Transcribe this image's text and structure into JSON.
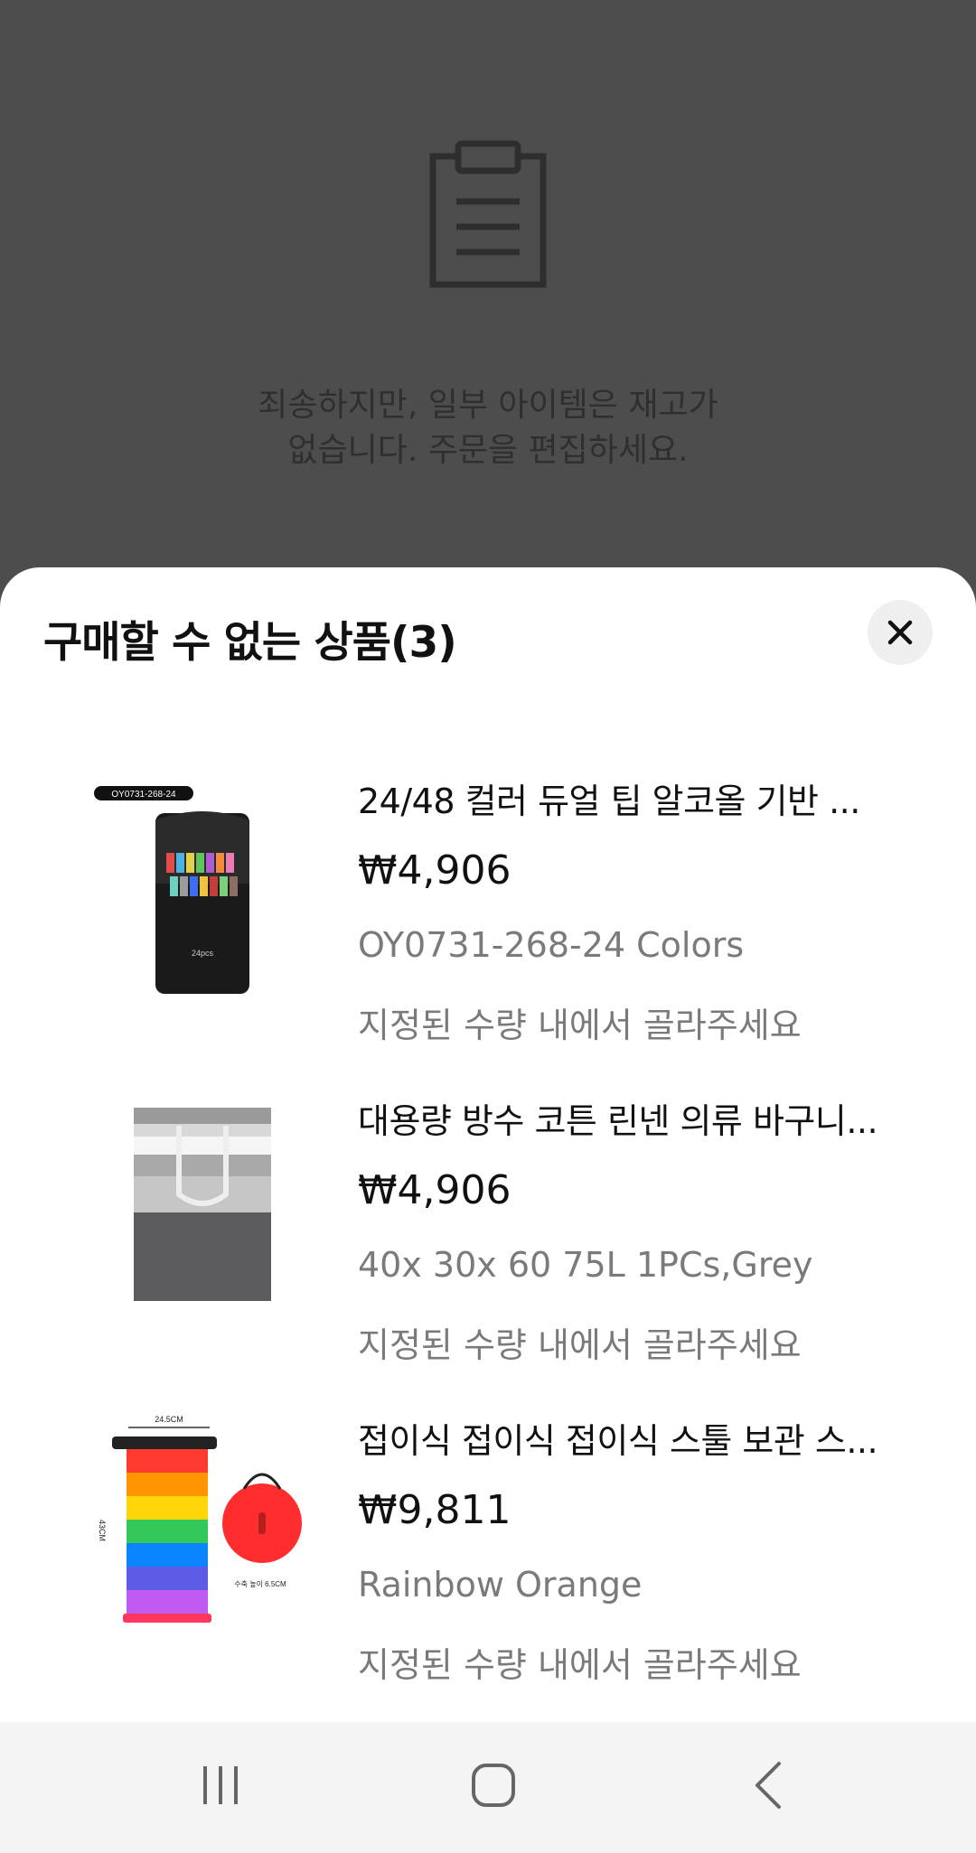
{
  "background": {
    "message": "죄송하지만, 일부 아이템은 재고가\n없습니다. 주문을 편집하세요.",
    "icon": "clipboard-icon"
  },
  "sheet": {
    "title": "구매할 수 없는 상품(3)",
    "close_icon": "close-icon"
  },
  "items": [
    {
      "name": "24/48 컬러 듀얼 팁 알코올 기반 ...",
      "price": "₩4,906",
      "option": "OY0731-268-24 Colors",
      "warning": "지정된 수량 내에서 골라주세요",
      "thumb_label": "OY0731-268-24",
      "thumb_text": "24pcs"
    },
    {
      "name": "대용량 방수 코튼 린넨 의류 바구니...",
      "price": "₩4,906",
      "option": "40x 30x 60 75L 1PCs,Grey",
      "warning": "지정된 수량 내에서 골라주세요"
    },
    {
      "name": "접이식 접이식 접이식 스툴 보관 스...",
      "price": "₩9,811",
      "option": "Rainbow Orange",
      "warning": "지정된 수량 내에서 골라주세요",
      "thumb_top": "24.5CM",
      "thumb_side": "43CM",
      "thumb_bottom": "수축 높이 6.5CM"
    }
  ],
  "navbar": {
    "recents_icon": "recents-icon",
    "home_icon": "home-icon",
    "back_icon": "back-icon"
  },
  "colors": {
    "scrim": "#4d4d4d",
    "sheet": "#ffffff",
    "secondary_text": "#7a7a7a",
    "navbar": "#f4f4f4"
  }
}
